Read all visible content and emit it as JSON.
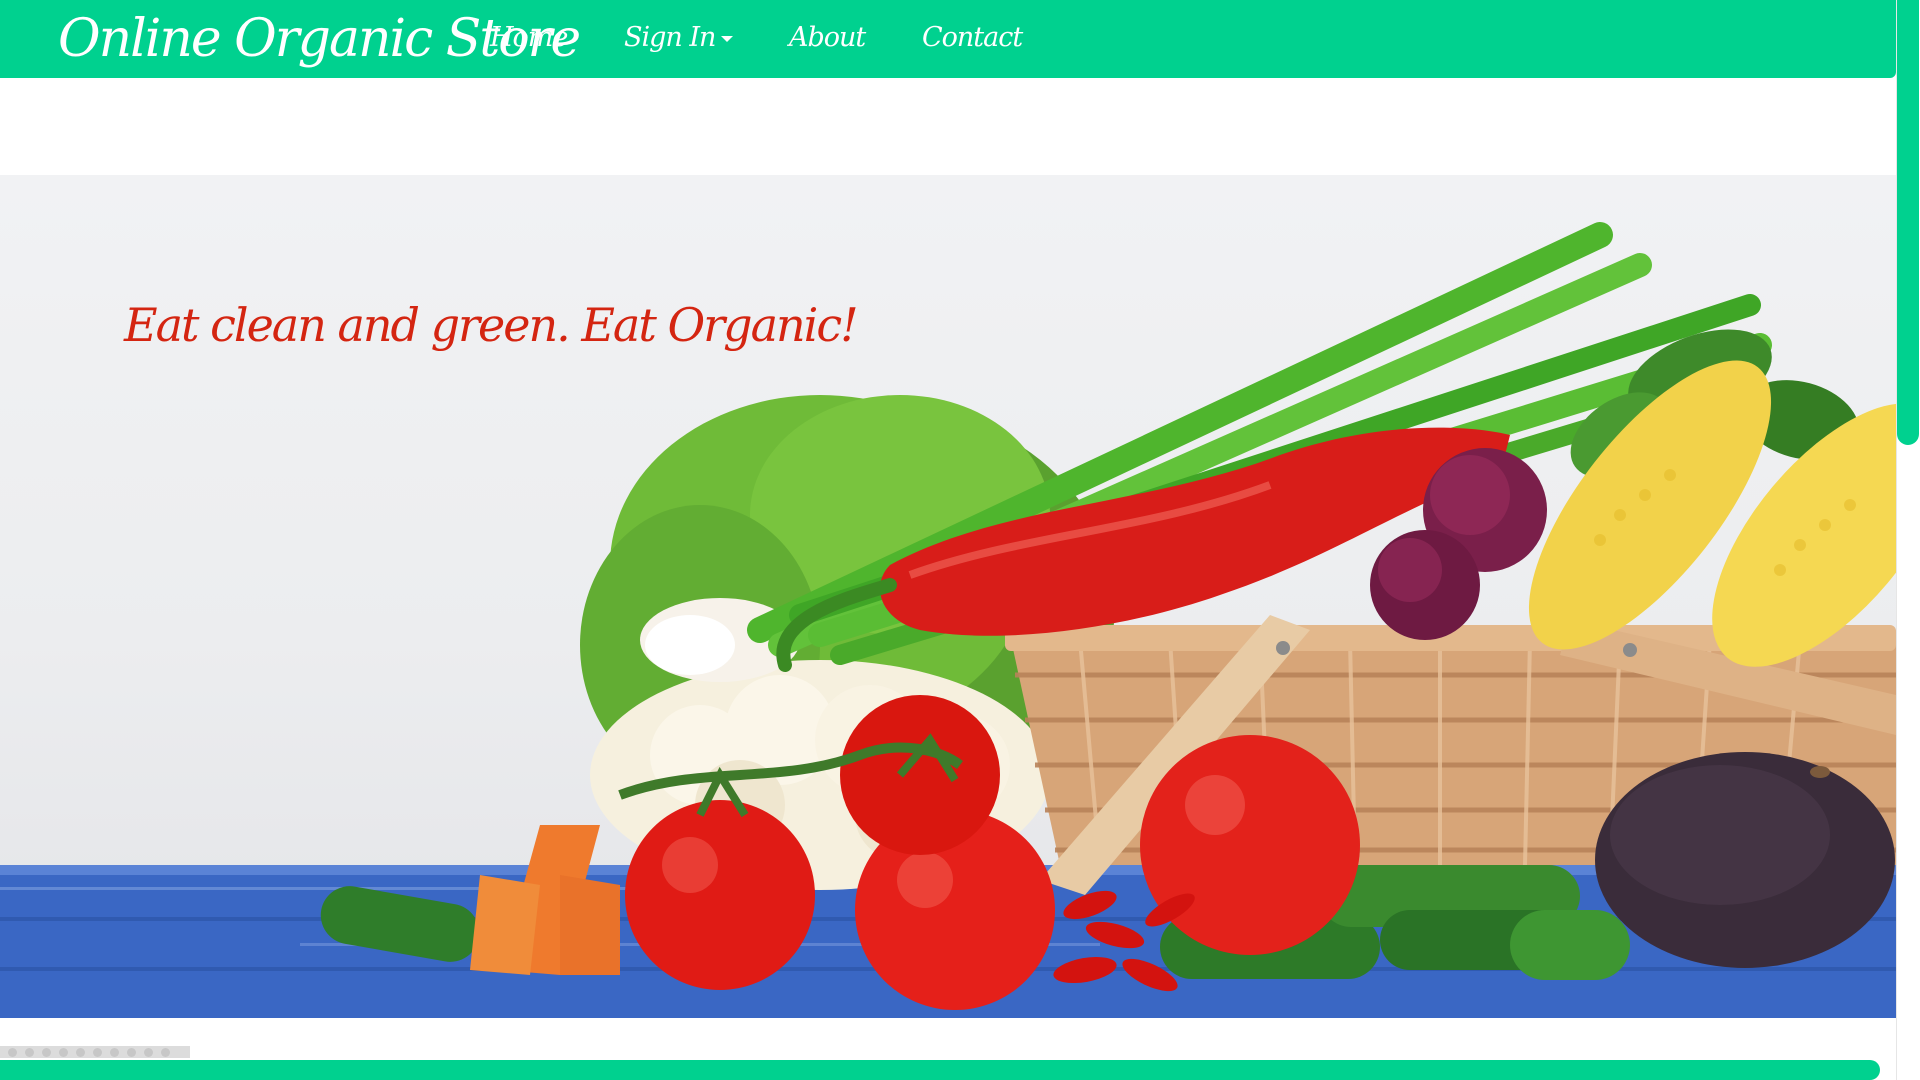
{
  "navbar": {
    "brand": "Online Organic Store",
    "links": {
      "home": "Home",
      "signin": "Sign In",
      "about": "About",
      "contact": "Contact"
    }
  },
  "hero": {
    "tagline": "Eat clean and green. Eat Organic!"
  },
  "colors": {
    "accent": "#00d18f",
    "tagline": "#d42511",
    "navText": "#ffffff"
  },
  "icons": {
    "dropdown": "chevron-down-icon"
  }
}
